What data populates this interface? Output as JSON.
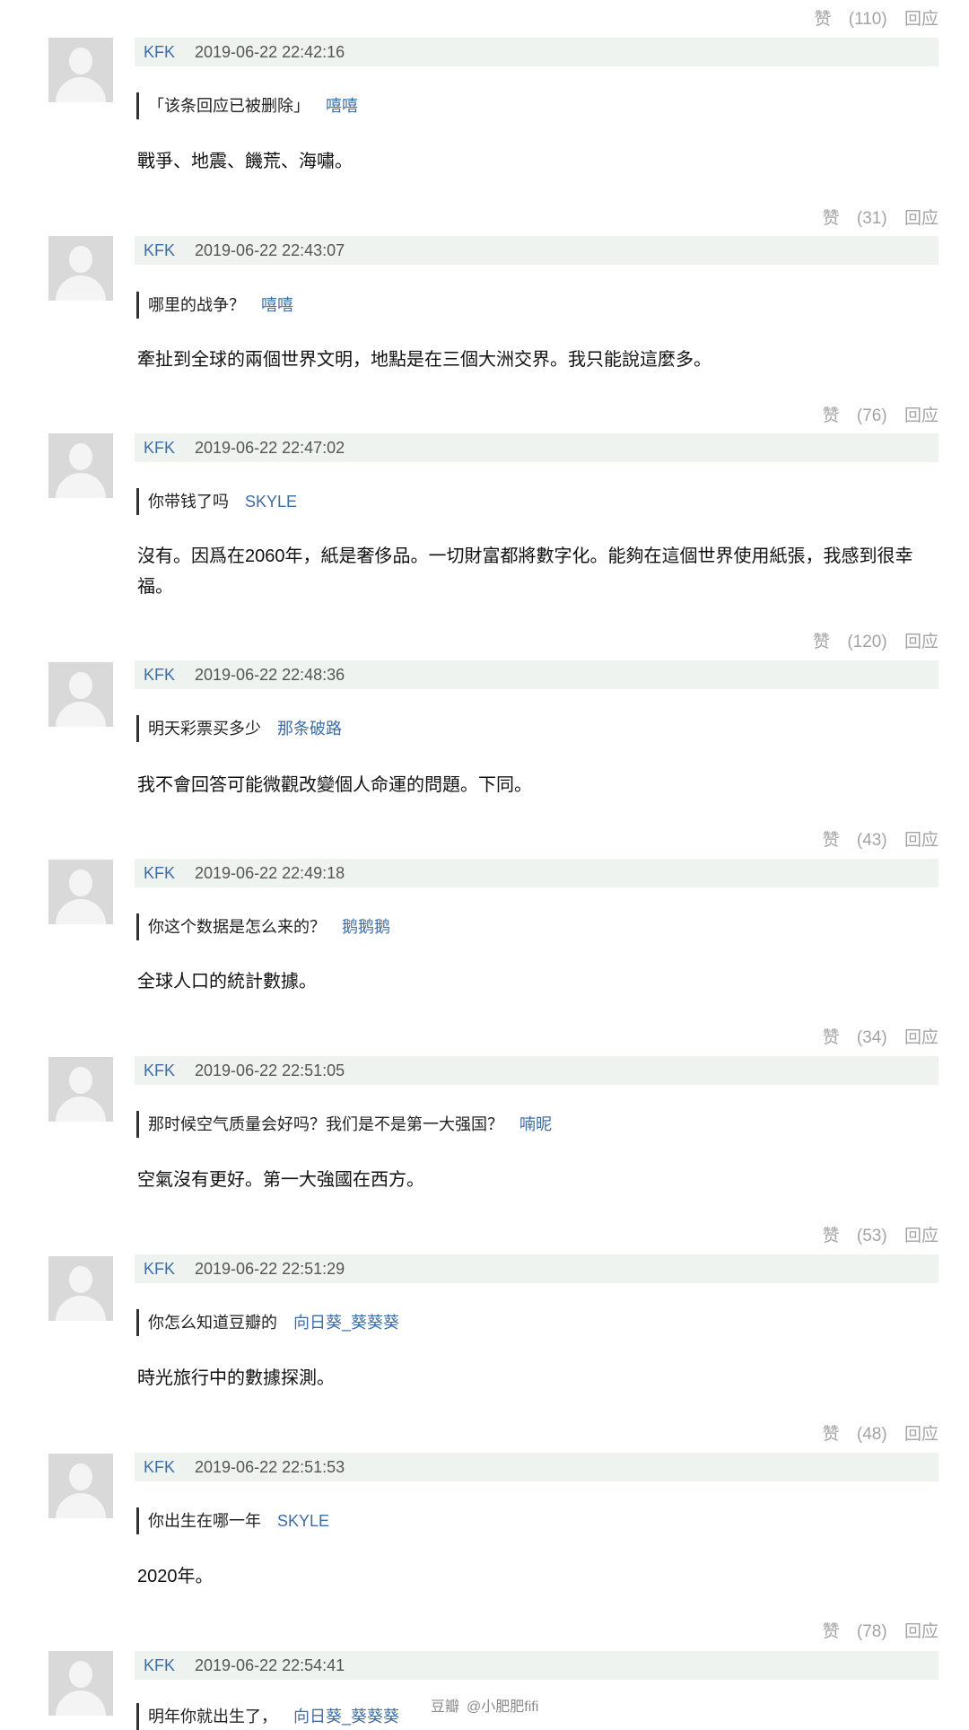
{
  "top_actions": {
    "like_label": "赞",
    "like_count": "(110)",
    "reply_label": "回应"
  },
  "comments": [
    {
      "user": "KFK",
      "time": "2019-06-22 22:42:16",
      "quote": "「该条回应已被删除」",
      "quote_author": "嘻嘻",
      "text": "戰爭、地震、饑荒、海嘯。",
      "like_label": "赞",
      "like_count": "(31)",
      "reply_label": "回应"
    },
    {
      "user": "KFK",
      "time": "2019-06-22 22:43:07",
      "quote": "哪里的战争？",
      "quote_author": "嘻嘻",
      "text": "牽扯到全球的兩個世界文明，地點是在三個大洲交界。我只能說這麼多。",
      "like_label": "赞",
      "like_count": "(76)",
      "reply_label": "回应"
    },
    {
      "user": "KFK",
      "time": "2019-06-22 22:47:02",
      "quote": "你带钱了吗",
      "quote_author": "SKYLE",
      "text": "沒有。因爲在2060年，紙是奢侈品。一切財富都將數字化。能夠在這個世界使用紙張，我感到很幸福。",
      "like_label": "赞",
      "like_count": "(120)",
      "reply_label": "回应"
    },
    {
      "user": "KFK",
      "time": "2019-06-22 22:48:36",
      "quote": "明天彩票买多少",
      "quote_author": "那条破路",
      "text": "我不會回答可能微觀改變個人命運的問題。下同。",
      "like_label": "赞",
      "like_count": "(43)",
      "reply_label": "回应"
    },
    {
      "user": "KFK",
      "time": "2019-06-22 22:49:18",
      "quote": "你这个数据是怎么来的？",
      "quote_author": "鹅鹅鹅",
      "text": "全球人口的統計數據。",
      "like_label": "赞",
      "like_count": "(34)",
      "reply_label": "回应"
    },
    {
      "user": "KFK",
      "time": "2019-06-22 22:51:05",
      "quote": "那时候空气质量会好吗？我们是不是第一大强国？",
      "quote_author": "喃昵",
      "text": "空氣沒有更好。第一大強國在西方。",
      "like_label": "赞",
      "like_count": "(53)",
      "reply_label": "回应"
    },
    {
      "user": "KFK",
      "time": "2019-06-22 22:51:29",
      "quote": "你怎么知道豆瓣的",
      "quote_author": "向日葵_葵葵葵",
      "text": "時光旅行中的數據探測。",
      "like_label": "赞",
      "like_count": "(48)",
      "reply_label": "回应"
    },
    {
      "user": "KFK",
      "time": "2019-06-22 22:51:53",
      "quote": "你出生在哪一年",
      "quote_author": "SKYLE",
      "text": "2020年。",
      "like_label": "赞",
      "like_count": "(78)",
      "reply_label": "回应"
    },
    {
      "user": "KFK",
      "time": "2019-06-22 22:54:41",
      "quote": "明年你就出生了，",
      "quote_author": "向日葵_葵葵葵",
      "text": "",
      "like_label": "",
      "like_count": "",
      "reply_label": ""
    }
  ],
  "watermark": {
    "site": "豆瓣",
    "handle": "@小肥肥fifi"
  }
}
